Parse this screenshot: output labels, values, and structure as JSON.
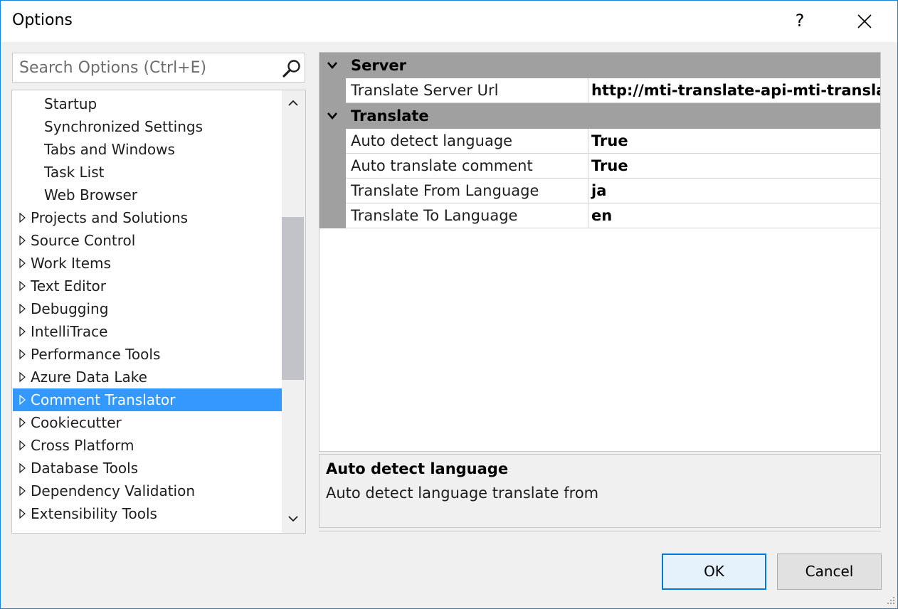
{
  "window": {
    "title": "Options",
    "help_label": "?"
  },
  "search": {
    "placeholder": "Search Options (Ctrl+E)"
  },
  "tree": {
    "children_visible": [
      "Startup",
      "Synchronized Settings",
      "Tabs and Windows",
      "Task List",
      "Web Browser"
    ],
    "items": [
      {
        "label": "Projects and Solutions"
      },
      {
        "label": "Source Control"
      },
      {
        "label": "Work Items"
      },
      {
        "label": "Text Editor"
      },
      {
        "label": "Debugging"
      },
      {
        "label": "IntelliTrace"
      },
      {
        "label": "Performance Tools"
      },
      {
        "label": "Azure Data Lake"
      },
      {
        "label": "Comment Translator",
        "selected": true
      },
      {
        "label": "Cookiecutter"
      },
      {
        "label": "Cross Platform"
      },
      {
        "label": "Database Tools"
      },
      {
        "label": "Dependency Validation"
      },
      {
        "label": "Extensibility Tools"
      }
    ],
    "selection_color": "#3399ff"
  },
  "properties": {
    "categories": [
      {
        "name": "Server",
        "props": [
          {
            "name": "Translate Server Url",
            "value": "http://mti-translate-api-mti-translat"
          }
        ]
      },
      {
        "name": "Translate",
        "props": [
          {
            "name": "Auto detect language",
            "value": "True"
          },
          {
            "name": "Auto translate comment",
            "value": "True"
          },
          {
            "name": "Translate From Language",
            "value": "ja"
          },
          {
            "name": "Translate To Language",
            "value": "en"
          }
        ]
      }
    ]
  },
  "description": {
    "title": "Auto detect language",
    "text": "Auto detect language translate from"
  },
  "buttons": {
    "ok": "OK",
    "cancel": "Cancel"
  },
  "colors": {
    "accent": "#0078d7",
    "category_bg": "#a0a0a0"
  }
}
